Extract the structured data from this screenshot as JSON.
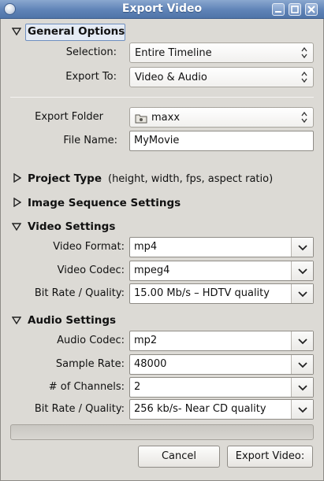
{
  "window": {
    "title": "Export Video"
  },
  "general": {
    "title": "General Options",
    "selection_label": "Selection:",
    "selection_value": "Entire Timeline",
    "export_to_label": "Export To:",
    "export_to_value": "Video & Audio",
    "export_folder_label": "Export Folder",
    "export_folder_value": "maxx",
    "file_name_label": "File Name:",
    "file_name_value": "MyMovie"
  },
  "project_type": {
    "title": "Project Type",
    "hint": "(height, width, fps, aspect ratio)"
  },
  "image_sequence": {
    "title": "Image Sequence Settings"
  },
  "video": {
    "title": "Video Settings",
    "format_label": "Video Format:",
    "format_value": "mp4",
    "codec_label": "Video Codec:",
    "codec_value": "mpeg4",
    "bitrate_label": "Bit Rate / Quality:",
    "bitrate_value": "15.00 Mb/s – HDTV quality"
  },
  "audio": {
    "title": "Audio Settings",
    "codec_label": "Audio Codec:",
    "codec_value": "mp2",
    "sample_rate_label": "Sample Rate:",
    "sample_rate_value": "48000",
    "channels_label": "# of Channels:",
    "channels_value": "2",
    "bitrate_label": "Bit Rate / Quality:",
    "bitrate_value": "256 kb/s- Near CD quality"
  },
  "progress": {
    "value": 0
  },
  "buttons": {
    "cancel": "Cancel",
    "export": "Export Video:"
  },
  "colors": {
    "titlebar": "#5f83b7",
    "background": "#dcdad5",
    "progress_fill": "#7aa2d8"
  },
  "icons": {
    "window": "app-icon",
    "minimize": "minimize-icon",
    "maximize": "maximize-icon",
    "close": "close-icon",
    "expanded": "triangle-down-icon",
    "collapsed": "triangle-right-icon",
    "combo": "spin-arrows-icon",
    "dropdown": "chevron-down-icon",
    "folder": "folder-icon"
  }
}
